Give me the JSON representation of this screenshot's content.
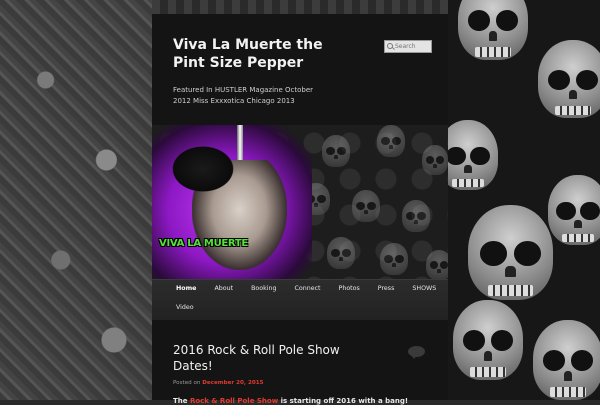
{
  "site": {
    "title": "Viva La Muerte the Pint Size Pepper",
    "description": "Featured In HUSTLER Magazine October 2012 Miss Exxxotica Chicago 2013"
  },
  "search": {
    "placeholder": "Search"
  },
  "banner": {
    "logo_text": "VIVA LA MUERTE"
  },
  "nav": {
    "items": [
      {
        "label": "Home"
      },
      {
        "label": "About"
      },
      {
        "label": "Booking"
      },
      {
        "label": "Connect"
      },
      {
        "label": "Photos"
      },
      {
        "label": "Press"
      },
      {
        "label": "SHOWS"
      },
      {
        "label": "Video"
      }
    ]
  },
  "post": {
    "title": "2016 Rock & Roll Pole Show Dates!",
    "meta_prefix": "Posted on",
    "date": "December 20, 2015",
    "body_prefix": "The",
    "body_link": "Rock & Roll Pole Show",
    "body_suffix": "is starting off 2016 with a bang!"
  },
  "icons": {
    "search": "search-icon",
    "comment": "comment-bubble-icon"
  },
  "colors": {
    "accent": "#e23a2f",
    "background": "#141414",
    "logo_green": "#55e33a",
    "banner_purple": "#8d18c4"
  }
}
